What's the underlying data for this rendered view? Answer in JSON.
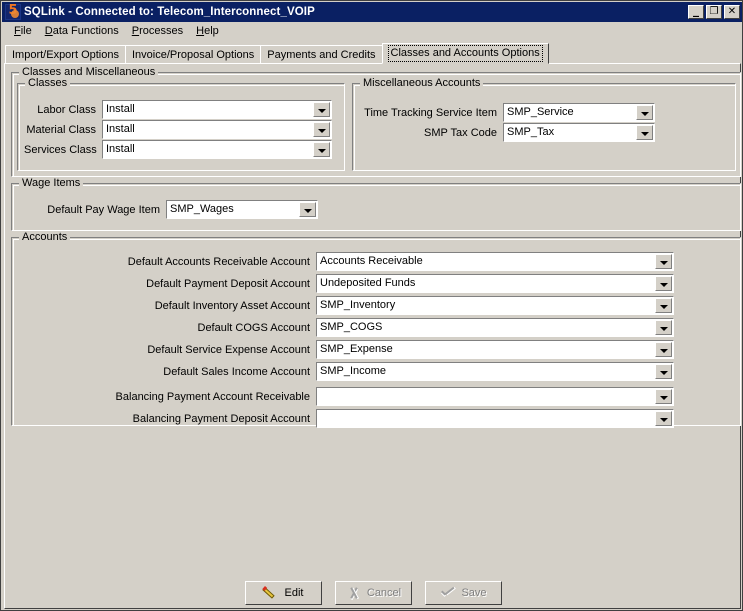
{
  "window": {
    "title": "SQLink - Connected to: Telecom_Interconnect_VOIP",
    "app_icon": "sqlink-logo-icon",
    "minimize_label": "_",
    "maximize_label": "❐",
    "close_label": "✕"
  },
  "menu": {
    "items": [
      {
        "accel": "F",
        "rest": "ile"
      },
      {
        "accel": "D",
        "rest": "ata Functions"
      },
      {
        "accel": "P",
        "rest": "rocesses"
      },
      {
        "accel": "H",
        "rest": "elp"
      }
    ]
  },
  "tabs": [
    {
      "label": "Import/Export Options",
      "active": false
    },
    {
      "label": "Invoice/Proposal Options",
      "active": false
    },
    {
      "label": "Payments and Credits",
      "active": false
    },
    {
      "label": "Classes and Accounts Options",
      "active": true
    }
  ],
  "groups": {
    "classes_misc": {
      "title": "Classes and Miscellaneous"
    },
    "classes": {
      "title": "Classes",
      "fields": [
        {
          "label": "Labor Class",
          "value": "Install"
        },
        {
          "label": "Material Class",
          "value": "Install"
        },
        {
          "label": "Services Class",
          "value": "Install"
        }
      ]
    },
    "misc_accounts": {
      "title": "Miscellaneous Accounts",
      "fields": [
        {
          "label": "Time Tracking Service Item",
          "value": "SMP_Service"
        },
        {
          "label": "SMP Tax Code",
          "value": "SMP_Tax"
        }
      ]
    },
    "wage_items": {
      "title": "Wage Items",
      "fields": [
        {
          "label": "Default Pay Wage Item",
          "value": "SMP_Wages"
        }
      ]
    },
    "accounts": {
      "title": "Accounts",
      "fields": [
        {
          "label": "Default Accounts Receivable Account",
          "value": "Accounts Receivable"
        },
        {
          "label": "Default Payment Deposit Account",
          "value": "Undeposited Funds"
        },
        {
          "label": "Default Inventory Asset Account",
          "value": "SMP_Inventory"
        },
        {
          "label": "Default COGS Account",
          "value": "SMP_COGS"
        },
        {
          "label": "Default Service Expense Account",
          "value": "SMP_Expense"
        },
        {
          "label": "Default Sales Income Account",
          "value": "SMP_Income"
        },
        {
          "label": "Balancing Payment Account Receivable",
          "value": ""
        },
        {
          "label": "Balancing Payment Deposit Account",
          "value": ""
        }
      ]
    }
  },
  "buttons": {
    "edit": {
      "label": "Edit",
      "icon": "pencil-icon",
      "disabled": false
    },
    "cancel": {
      "label": "Cancel",
      "icon": "cancel-icon",
      "disabled": true
    },
    "save": {
      "label": "Save",
      "icon": "check-icon",
      "disabled": true
    }
  },
  "colors": {
    "title_bar": "#0a2063",
    "face": "#d4d0c8",
    "field_bg": "#ffffff",
    "disabled_text": "#808080"
  }
}
